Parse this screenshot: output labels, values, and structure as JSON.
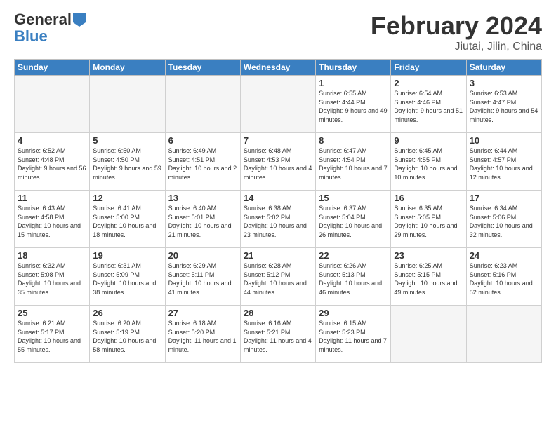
{
  "header": {
    "logo_general": "General",
    "logo_blue": "Blue",
    "main_title": "February 2024",
    "subtitle": "Jiutai, Jilin, China"
  },
  "weekdays": [
    "Sunday",
    "Monday",
    "Tuesday",
    "Wednesday",
    "Thursday",
    "Friday",
    "Saturday"
  ],
  "weeks": [
    [
      {
        "day": "",
        "info": ""
      },
      {
        "day": "",
        "info": ""
      },
      {
        "day": "",
        "info": ""
      },
      {
        "day": "",
        "info": ""
      },
      {
        "day": "1",
        "info": "Sunrise: 6:55 AM\nSunset: 4:44 PM\nDaylight: 9 hours\nand 49 minutes."
      },
      {
        "day": "2",
        "info": "Sunrise: 6:54 AM\nSunset: 4:46 PM\nDaylight: 9 hours\nand 51 minutes."
      },
      {
        "day": "3",
        "info": "Sunrise: 6:53 AM\nSunset: 4:47 PM\nDaylight: 9 hours\nand 54 minutes."
      }
    ],
    [
      {
        "day": "4",
        "info": "Sunrise: 6:52 AM\nSunset: 4:48 PM\nDaylight: 9 hours\nand 56 minutes."
      },
      {
        "day": "5",
        "info": "Sunrise: 6:50 AM\nSunset: 4:50 PM\nDaylight: 9 hours\nand 59 minutes."
      },
      {
        "day": "6",
        "info": "Sunrise: 6:49 AM\nSunset: 4:51 PM\nDaylight: 10 hours\nand 2 minutes."
      },
      {
        "day": "7",
        "info": "Sunrise: 6:48 AM\nSunset: 4:53 PM\nDaylight: 10 hours\nand 4 minutes."
      },
      {
        "day": "8",
        "info": "Sunrise: 6:47 AM\nSunset: 4:54 PM\nDaylight: 10 hours\nand 7 minutes."
      },
      {
        "day": "9",
        "info": "Sunrise: 6:45 AM\nSunset: 4:55 PM\nDaylight: 10 hours\nand 10 minutes."
      },
      {
        "day": "10",
        "info": "Sunrise: 6:44 AM\nSunset: 4:57 PM\nDaylight: 10 hours\nand 12 minutes."
      }
    ],
    [
      {
        "day": "11",
        "info": "Sunrise: 6:43 AM\nSunset: 4:58 PM\nDaylight: 10 hours\nand 15 minutes."
      },
      {
        "day": "12",
        "info": "Sunrise: 6:41 AM\nSunset: 5:00 PM\nDaylight: 10 hours\nand 18 minutes."
      },
      {
        "day": "13",
        "info": "Sunrise: 6:40 AM\nSunset: 5:01 PM\nDaylight: 10 hours\nand 21 minutes."
      },
      {
        "day": "14",
        "info": "Sunrise: 6:38 AM\nSunset: 5:02 PM\nDaylight: 10 hours\nand 23 minutes."
      },
      {
        "day": "15",
        "info": "Sunrise: 6:37 AM\nSunset: 5:04 PM\nDaylight: 10 hours\nand 26 minutes."
      },
      {
        "day": "16",
        "info": "Sunrise: 6:35 AM\nSunset: 5:05 PM\nDaylight: 10 hours\nand 29 minutes."
      },
      {
        "day": "17",
        "info": "Sunrise: 6:34 AM\nSunset: 5:06 PM\nDaylight: 10 hours\nand 32 minutes."
      }
    ],
    [
      {
        "day": "18",
        "info": "Sunrise: 6:32 AM\nSunset: 5:08 PM\nDaylight: 10 hours\nand 35 minutes."
      },
      {
        "day": "19",
        "info": "Sunrise: 6:31 AM\nSunset: 5:09 PM\nDaylight: 10 hours\nand 38 minutes."
      },
      {
        "day": "20",
        "info": "Sunrise: 6:29 AM\nSunset: 5:11 PM\nDaylight: 10 hours\nand 41 minutes."
      },
      {
        "day": "21",
        "info": "Sunrise: 6:28 AM\nSunset: 5:12 PM\nDaylight: 10 hours\nand 44 minutes."
      },
      {
        "day": "22",
        "info": "Sunrise: 6:26 AM\nSunset: 5:13 PM\nDaylight: 10 hours\nand 46 minutes."
      },
      {
        "day": "23",
        "info": "Sunrise: 6:25 AM\nSunset: 5:15 PM\nDaylight: 10 hours\nand 49 minutes."
      },
      {
        "day": "24",
        "info": "Sunrise: 6:23 AM\nSunset: 5:16 PM\nDaylight: 10 hours\nand 52 minutes."
      }
    ],
    [
      {
        "day": "25",
        "info": "Sunrise: 6:21 AM\nSunset: 5:17 PM\nDaylight: 10 hours\nand 55 minutes."
      },
      {
        "day": "26",
        "info": "Sunrise: 6:20 AM\nSunset: 5:19 PM\nDaylight: 10 hours\nand 58 minutes."
      },
      {
        "day": "27",
        "info": "Sunrise: 6:18 AM\nSunset: 5:20 PM\nDaylight: 11 hours\nand 1 minute."
      },
      {
        "day": "28",
        "info": "Sunrise: 6:16 AM\nSunset: 5:21 PM\nDaylight: 11 hours\nand 4 minutes."
      },
      {
        "day": "29",
        "info": "Sunrise: 6:15 AM\nSunset: 5:23 PM\nDaylight: 11 hours\nand 7 minutes."
      },
      {
        "day": "",
        "info": ""
      },
      {
        "day": "",
        "info": ""
      }
    ]
  ]
}
